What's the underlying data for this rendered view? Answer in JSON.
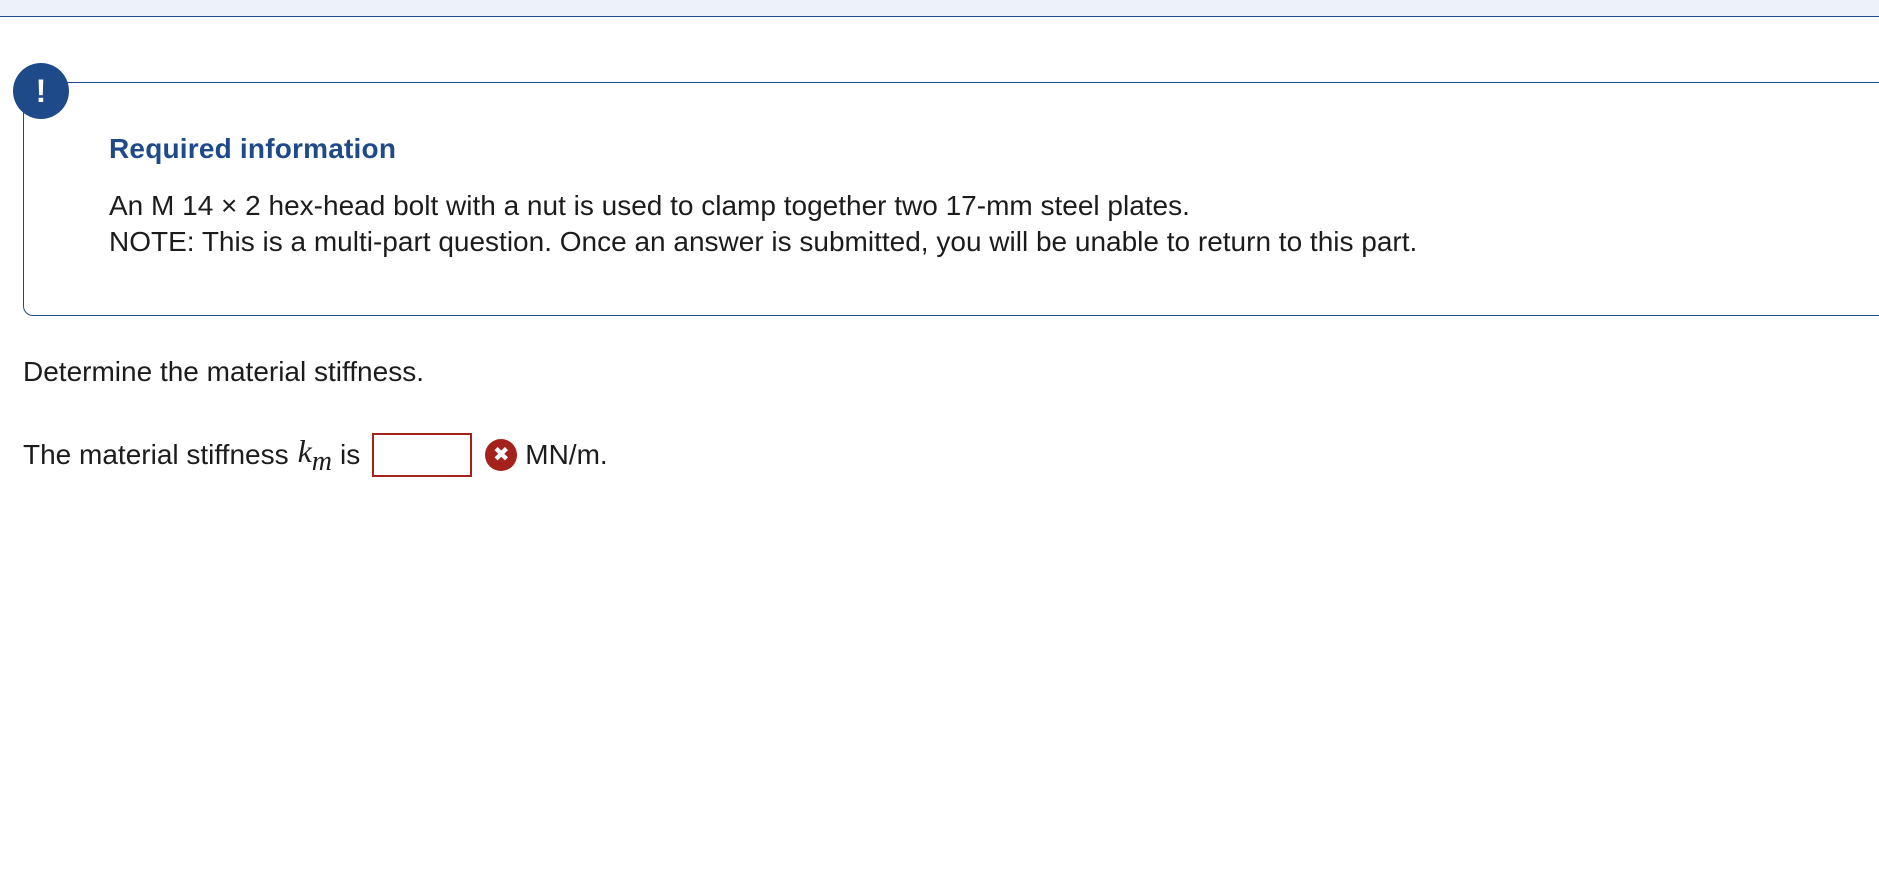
{
  "alert": {
    "icon_symbol": "!",
    "icon_name": "exclamation-icon",
    "title": "Required information",
    "line1": "An M 14 × 2 hex-head bolt with a nut is used to clamp together two 17-mm steel plates.",
    "line2": "NOTE: This is a multi-part question. Once an answer is submitted, you will be unable to return to this part."
  },
  "question": {
    "prompt": "Determine the material stiffness.",
    "answer_prefix": "The material stiffness",
    "variable_base": "k",
    "variable_sub": "m",
    "answer_mid": "is",
    "answer_value": "",
    "answer_placeholder": "",
    "status_icon_name": "error-x-icon",
    "status_symbol": "✖",
    "unit": "MN/m."
  },
  "colors": {
    "accent": "#1f4a8a",
    "error": "#a3221c"
  }
}
